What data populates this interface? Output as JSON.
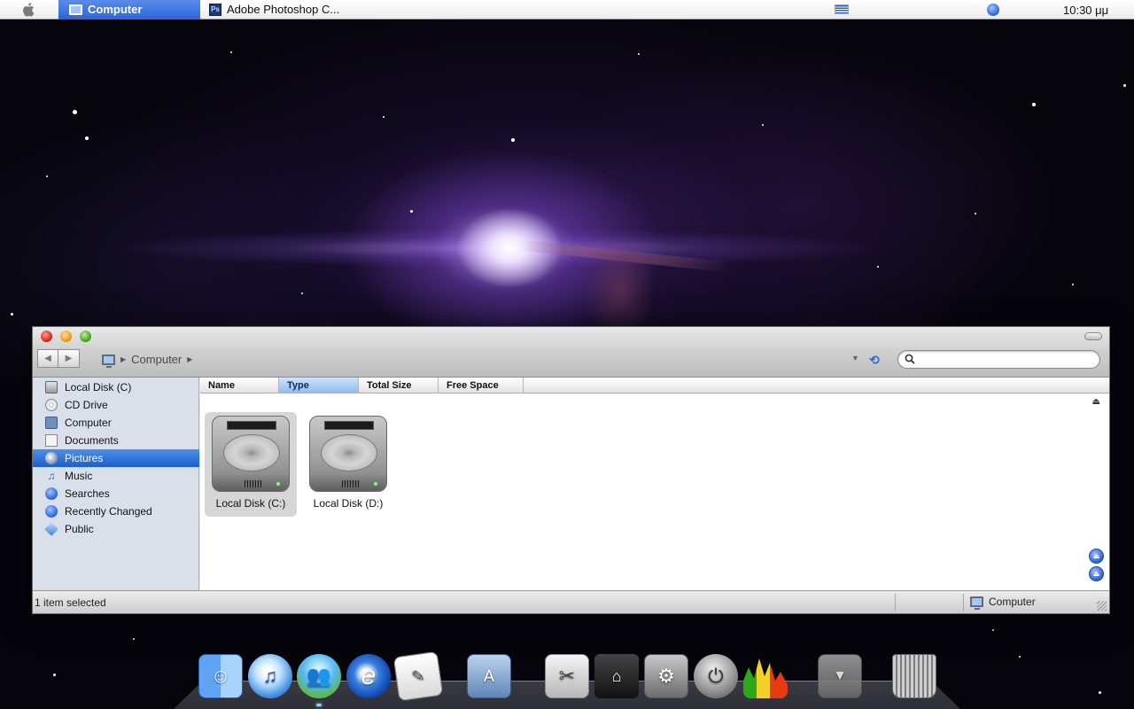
{
  "menubar": {
    "active_app": "Computer",
    "task": "Adobe Photoshop C...",
    "task_icon_letters": "Ps",
    "clock": "10:30 μμ"
  },
  "window": {
    "breadcrumb": "Computer",
    "search": {
      "value": "",
      "placeholder": ""
    },
    "sidebar": [
      {
        "label": "Local Disk (C)",
        "icon": "local-disk-icon",
        "selected": false
      },
      {
        "label": "CD Drive",
        "icon": "cd-drive-icon",
        "selected": false
      },
      {
        "label": "Computer",
        "icon": "computer-icon",
        "selected": false
      },
      {
        "label": "Documents",
        "icon": "documents-icon",
        "selected": false
      },
      {
        "label": "Pictures",
        "icon": "pictures-icon",
        "selected": true
      },
      {
        "label": "Music",
        "icon": "music-icon",
        "selected": false
      },
      {
        "label": "Searches",
        "icon": "search-folder-icon",
        "selected": false
      },
      {
        "label": "Recently Changed",
        "icon": "recently-changed-icon",
        "selected": false
      },
      {
        "label": "Public",
        "icon": "public-icon",
        "selected": false
      }
    ],
    "columns": [
      {
        "label": "Name",
        "active": false
      },
      {
        "label": "Type",
        "active": true
      },
      {
        "label": "Total Size",
        "active": false
      },
      {
        "label": "Free Space",
        "active": false
      }
    ],
    "items": [
      {
        "label": "Local Disk (C:)",
        "selected": true
      },
      {
        "label": "Local Disk (D:)",
        "selected": false
      }
    ],
    "status": {
      "selection": "1 item selected",
      "location": "Computer"
    }
  },
  "dock": [
    {
      "name": "finder",
      "icon": "finder-icon"
    },
    {
      "name": "itunes",
      "icon": "itunes-icon"
    },
    {
      "name": "messenger",
      "icon": "messenger-icon"
    },
    {
      "name": "internet-explorer",
      "icon": "internet-explorer-icon"
    },
    {
      "name": "text-edit",
      "icon": "text-edit-icon"
    },
    {
      "name": "applications",
      "icon": "applications-folder-icon"
    },
    {
      "name": "grab",
      "icon": "grab-icon"
    },
    {
      "name": "network",
      "icon": "network-icon"
    },
    {
      "name": "system-preferences",
      "icon": "system-preferences-icon"
    },
    {
      "name": "power",
      "icon": "power-icon"
    },
    {
      "name": "activity-meter",
      "icon": "activity-meter-icon"
    },
    {
      "name": "downloads",
      "icon": "downloads-stack-icon"
    },
    {
      "name": "trash",
      "icon": "trash-icon"
    }
  ],
  "colors": {
    "menu_highlight": "#2a64d6",
    "selection": "#1c5fcd",
    "sidebar_bg": "#d9e0ea"
  }
}
